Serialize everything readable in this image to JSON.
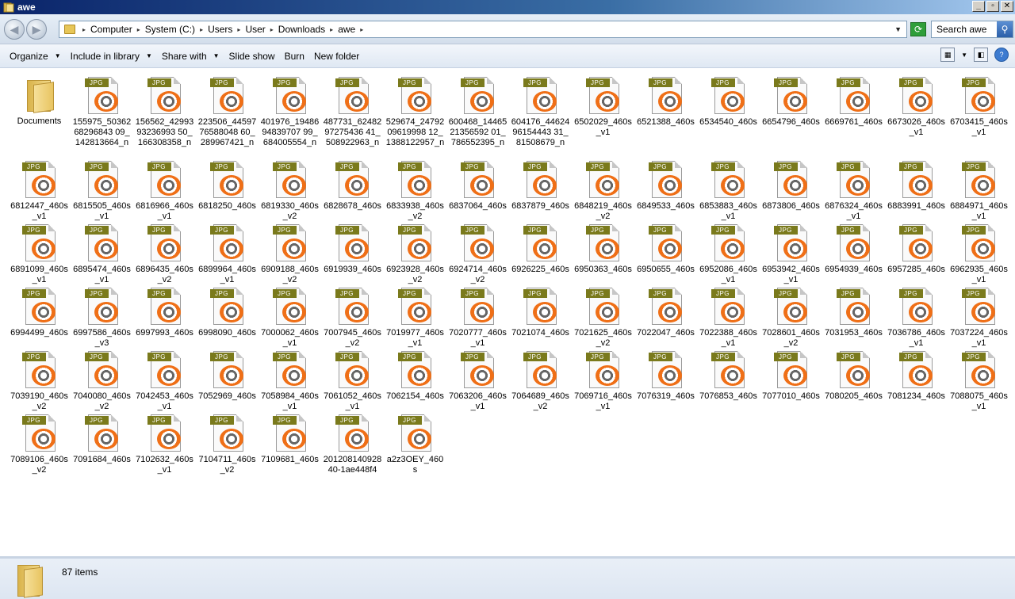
{
  "window": {
    "title": "awe",
    "buttons": [
      "_",
      "▫",
      "✕"
    ]
  },
  "address": {
    "crumbs": [
      "Computer",
      "System (C:)",
      "Users",
      "User",
      "Downloads",
      "awe"
    ],
    "search_placeholder": "Search awe"
  },
  "toolbar": {
    "organize": "Organize",
    "include_in_library": "Include in library",
    "share_with": "Share with",
    "slide_show": "Slide show",
    "burn": "Burn",
    "new_folder": "New folder"
  },
  "folder": {
    "label": "Documents",
    "icon": "folder-icon"
  },
  "file_badge": "JPG",
  "files": [
    "155975_5036268296843 09_142813664_n",
    "156562_4299393236993 50_166308358_n",
    "223506_4459776588048 60_289967421_n",
    "401976_1948694839707 99_684005554_n",
    "487731_6248297275436 41_508922963_n",
    "529674_2479209619998 12_1388122957_n",
    "600468_1446521356592 01_786552395_n",
    "604176_4462496154443 31_81508679_n",
    "6502029_460s_v1",
    "6521388_460s",
    "6534540_460s",
    "6654796_460s",
    "6669761_460s",
    "6673026_460s_v1",
    "6703415_460s_v1",
    "6812447_460s_v1",
    "6815505_460s_v1",
    "6816966_460s_v1",
    "6818250_460s",
    "6819330_460s_v2",
    "6828678_460s",
    "6833938_460s_v2",
    "6837064_460s",
    "6837879_460s",
    "6848219_460s_v2",
    "6849533_460s",
    "6853883_460s_v1",
    "6873806_460s",
    "6876324_460s_v1",
    "6883991_460s",
    "6884971_460s_v1",
    "6891099_460s_v1",
    "6895474_460s_v1",
    "6896435_460s_v2",
    "6899964_460s_v1",
    "6909188_460s_v2",
    "6919939_460s",
    "6923928_460s_v2",
    "6924714_460s_v2",
    "6926225_460s",
    "6950363_460s",
    "6950655_460s",
    "6952086_460s_v1",
    "6953942_460s_v1",
    "6954939_460s",
    "6957285_460s",
    "6962935_460s_v1",
    "6994499_460s",
    "6997586_460s_v3",
    "6997993_460s",
    "6998090_460s",
    "7000062_460s_v1",
    "7007945_460s_v2",
    "7019977_460s_v1",
    "7020777_460s_v1",
    "7021074_460s",
    "7021625_460s_v2",
    "7022047_460s",
    "7022388_460s_v1",
    "7028601_460s_v2",
    "7031953_460s",
    "7036786_460s_v1",
    "7037224_460s_v1",
    "7039190_460s_v2",
    "7040080_460s_v2",
    "7042453_460s_v1",
    "7052969_460s",
    "7058984_460s_v1",
    "7061052_460s_v1",
    "7062154_460s",
    "7063206_460s_v1",
    "7064689_460s_v2",
    "7069716_460s_v1",
    "7076319_460s",
    "7076853_460s",
    "7077010_460s",
    "7080205_460s",
    "7081234_460s",
    "7088075_460s_v1",
    "7089106_460s_v2",
    "7091684_460s",
    "7102632_460s_v1",
    "7104711_460s_v2",
    "7109681_460s",
    "201208140928 40-1ae448f4",
    "a2z3OEY_460s"
  ],
  "status": {
    "count": "87 items"
  }
}
